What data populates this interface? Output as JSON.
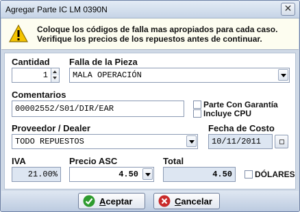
{
  "window": {
    "title": "Agregar Parte IC LM 0390N",
    "close_glyph": "✕"
  },
  "banner": {
    "icon": "warning-icon",
    "line1": "Coloque los códigos de falla mas apropiados para cada caso.",
    "line2": "Verifique los precios de los repuestos antes de continuar."
  },
  "form": {
    "cantidad_label": "Cantidad",
    "cantidad_value": "1",
    "falla_label": "Falla de la Pieza",
    "falla_value": "MALA OPERACIÓN",
    "comentarios_label": "Comentarios",
    "comentarios_value": "00002552/S01/DIR/EAR",
    "garantia_label": "Parte Con Garantía",
    "garantia_checked": false,
    "cpu_label": "Incluye CPU",
    "cpu_checked": false,
    "proveedor_label": "Proveedor / Dealer",
    "proveedor_value": "TODO REPUESTOS",
    "fecha_label": "Fecha de Costo",
    "fecha_value": "10/11/2011",
    "iva_label": "IVA",
    "iva_value": "21.00%",
    "precio_label": "Precio ASC",
    "precio_value": "4.50",
    "total_label": "Total",
    "total_value": "4.50",
    "dolares_label": "DÓLARES",
    "dolares_checked": false
  },
  "buttons": {
    "accept_key": "A",
    "accept_rest": "ceptar",
    "cancel_key": "C",
    "cancel_rest": "ancelar"
  },
  "colors": {
    "accept_icon": "#2e9b2e",
    "cancel_icon": "#c92a2a",
    "warning": "#f5c400"
  }
}
